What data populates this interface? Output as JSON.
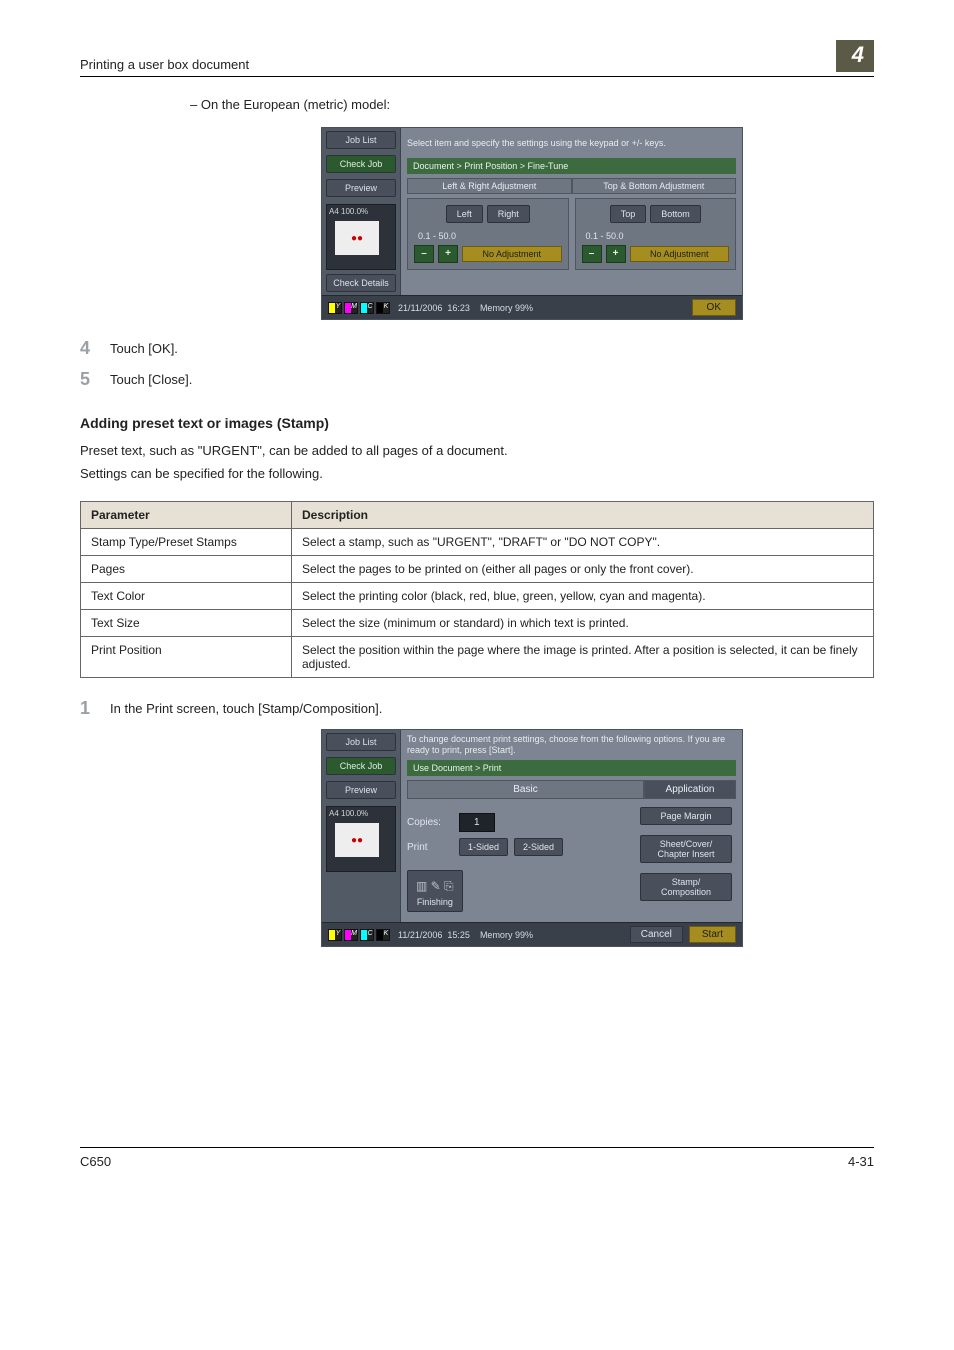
{
  "header": {
    "title": "Printing a user box document",
    "chapter": "4"
  },
  "intro_dash": "– On the European (metric) model:",
  "panel1": {
    "job_list": "Job List",
    "check_job": "Check Job",
    "preview": "Preview",
    "preview_info": "A4   100.0%",
    "check_details": "Check Details",
    "help": "Select item and specify the settings using the keypad or +/- keys.",
    "breadcrumb": "Document > Print Position > Fine-Tune",
    "hdr_left": "Left & Right Adjustment",
    "hdr_right": "Top & Bottom Adjustment",
    "left": "Left",
    "right": "Right",
    "top": "Top",
    "bottom": "Bottom",
    "range": "0.1  -  50.0",
    "minus": "–",
    "plus": "+",
    "noadj": "No Adjustment",
    "date": "21/11/2006",
    "time": "16:23",
    "memory": "Memory",
    "mempct": "99%",
    "ok": "OK",
    "toner": {
      "y": "Y",
      "m": "M",
      "c": "C",
      "k": "K"
    }
  },
  "steps_a": [
    {
      "n": "4",
      "t": "Touch [OK]."
    },
    {
      "n": "5",
      "t": "Touch [Close]."
    }
  ],
  "stamp": {
    "heading": "Adding preset text or images (Stamp)",
    "p1": "Preset text, such as \"URGENT\", can be added to all pages of a document.",
    "p2": "Settings can be specified for the following.",
    "th1": "Parameter",
    "th2": "Description",
    "rows": [
      {
        "p": "Stamp Type/Preset Stamps",
        "d": "Select a stamp, such as \"URGENT\", \"DRAFT\" or \"DO NOT COPY\"."
      },
      {
        "p": "Pages",
        "d": "Select the pages to be printed on (either all pages or only the front cover)."
      },
      {
        "p": "Text Color",
        "d": "Select the printing color (black, red, blue, green, yellow, cyan and magenta)."
      },
      {
        "p": "Text Size",
        "d": "Select the size (minimum or standard) in which text is printed."
      },
      {
        "p": "Print Position",
        "d": "Select the position within the page where the image is printed. After a position is selected, it can be finely adjusted."
      }
    ]
  },
  "steps_b": [
    {
      "n": "1",
      "t": "In the Print screen, touch [Stamp/Composition]."
    }
  ],
  "panel2": {
    "job_list": "Job List",
    "check_job": "Check Job",
    "preview": "Preview",
    "preview_info": "A4   100.0%",
    "help": "To change document print settings, choose from the following options. If you are ready to print, press [Start].",
    "breadcrumb": "Use Document > Print",
    "tab_basic": "Basic",
    "tab_appl": "Application",
    "copies_lbl": "Copies:",
    "copies_val": "1",
    "page_margin": "Page Margin",
    "print_lbl": "Print",
    "one_sided": "1-Sided",
    "two_sided": "2-Sided",
    "sheet_cover": "Sheet/Cover/\nChapter Insert",
    "stamp_comp": "Stamp/\nComposition",
    "finishing": "Finishing",
    "date": "11/21/2006",
    "time": "15:25",
    "memory": "Memory",
    "mempct": "99%",
    "cancel": "Cancel",
    "start": "Start"
  },
  "footer": {
    "left": "C650",
    "right": "4-31"
  }
}
